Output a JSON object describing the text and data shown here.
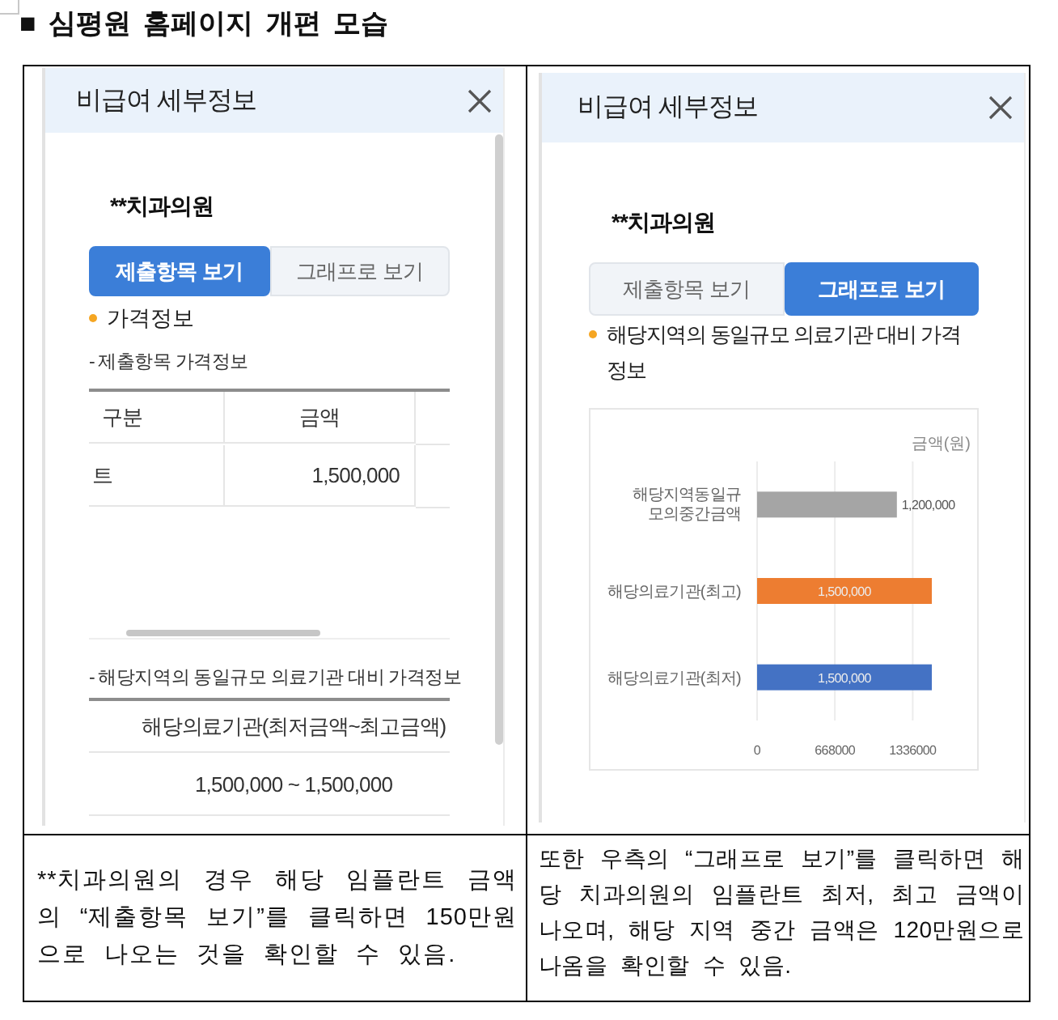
{
  "title": "■ 심평원 홈페이지 개편 모습",
  "panels": [
    {
      "kind": "list",
      "header": "비급여 세부정보",
      "clinic": "**치과의원",
      "tabs": [
        {
          "label": "제출항목 보기",
          "selected": true
        },
        {
          "label": "그래프로 보기",
          "selected": false
        }
      ],
      "section": "가격정보",
      "subsections": [
        {
          "kind": "scroll",
          "title": "- 제출항목 가격정보",
          "table": {
            "columns": [
              "구분",
              "금액"
            ],
            "rows": [
              [
                "트",
                "1,500,000"
              ]
            ]
          }
        },
        {
          "kind": "plain",
          "title": "- 해당지역의 동일규모 의료기관 대비 가격정보",
          "table": {
            "columns": [
              "해당의료기관(최저금액~최고금액)"
            ],
            "rows": [
              [
                "1,500,000 ~ 1,500,000"
              ]
            ]
          }
        }
      ]
    },
    {
      "kind": "graph",
      "header": "비급여 세부정보",
      "clinic": "**치과의원",
      "tabs": [
        {
          "label": "제출항목 보기",
          "selected": false
        },
        {
          "label": "그래프로 보기",
          "selected": true
        }
      ],
      "section": "해당지역의 동일규모 의료기관 대비 가격 정보",
      "chart_data": {
        "type": "bar",
        "orientation": "horizontal",
        "xlabel": "금액(원)",
        "categories": [
          "해당지역동일규모의중간금액",
          "해당의료기관(최고)",
          "해당의료기관(최저)"
        ],
        "series": [
          {
            "color": "#a5a5a5",
            "values": [
              1200000,
              null,
              null
            ]
          },
          {
            "color": "#ed7d31",
            "values": [
              null,
              1500000,
              null
            ]
          },
          {
            "color": "#4472c4",
            "values": [
              null,
              null,
              1500000
            ]
          }
        ],
        "stacked": true,
        "xlim": [
          0,
          1500000
        ],
        "xticks": [
          0,
          668000,
          1336000
        ],
        "value_labels": [
          "1,200,000",
          "1,500,000",
          "1,500,000"
        ]
      }
    }
  ],
  "notes": [
    "**치과의원의 경우 해당 임플란트 금액의 “제출항목 보기”를 클릭하면 150만원으로 나오는 것을 확인할 수 있음.",
    "또한 우측의 “그래프로 보기”를 클릭하면 해당 치과의원의 임플란트 최저, 최고 금액이 나오며, 해당 지역 중간 금액은 120만원으로 나옴을 확인할 수 있음."
  ]
}
